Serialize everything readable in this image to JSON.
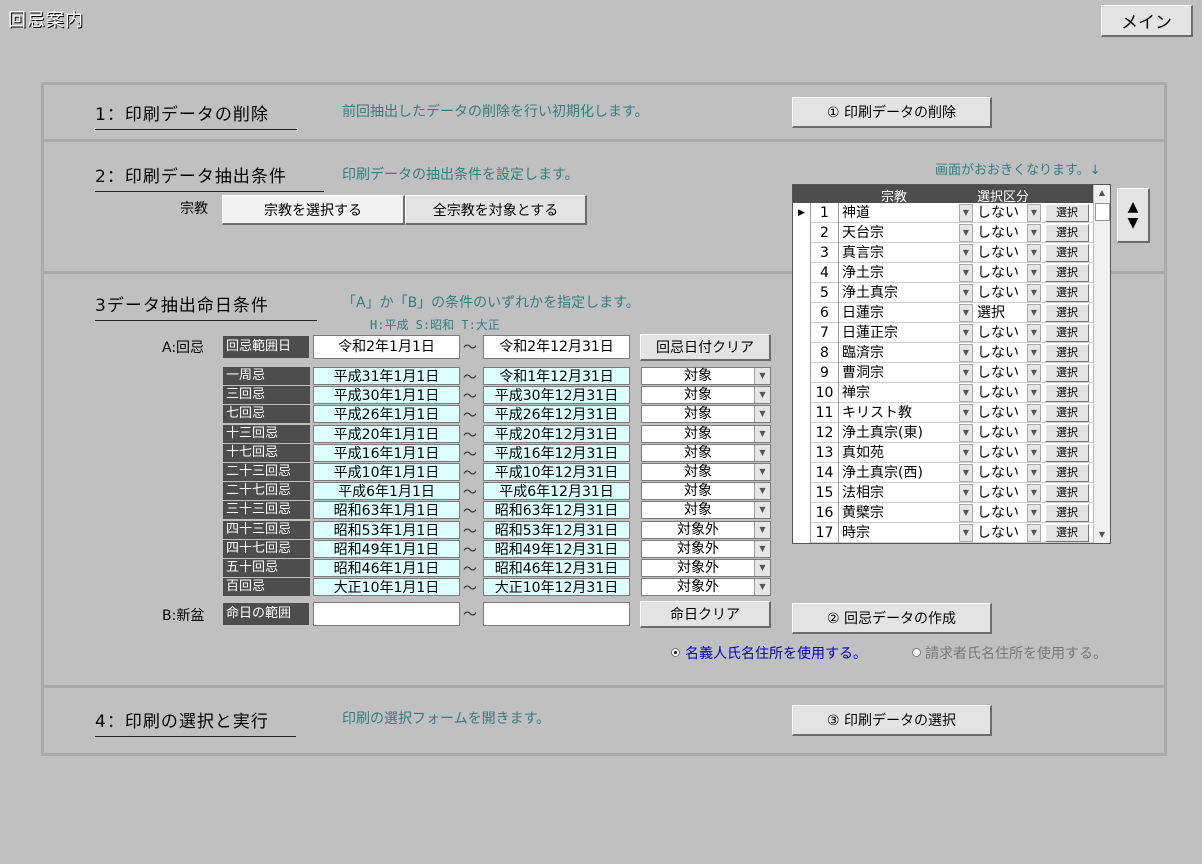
{
  "window": {
    "title": "回忌案内",
    "main_button": "メイン"
  },
  "section1": {
    "heading": "1：印刷データの削除",
    "description": "前回抽出したデータの削除を行い初期化します。",
    "button": "① 印刷データの削除"
  },
  "section2": {
    "heading": "2：印刷データ抽出条件",
    "description": "印刷データの抽出条件を設定します。",
    "sect_label": "宗教",
    "select_button": "宗教を選択する",
    "all_button": "全宗教を対象とする",
    "enlarge_hint": "画面がおおきくなります。↓"
  },
  "section3": {
    "heading": "3データ抽出命日条件",
    "description": "「A」か「B」の条件のいずれかを指定します。",
    "era_legend": "H:平成 S:昭和 T:大正",
    "a_label": "A:回忌",
    "range_label": "回忌範囲日",
    "range_from": "令和2年1月1日",
    "range_to": "令和2年12月31日",
    "clear_button": "回忌日付クリア",
    "kaiki_rows": [
      {
        "name": "一周忌",
        "from": "平成31年1月1日",
        "to": "令和1年12月31日",
        "status": "対象"
      },
      {
        "name": "三回忌",
        "from": "平成30年1月1日",
        "to": "平成30年12月31日",
        "status": "対象"
      },
      {
        "name": "七回忌",
        "from": "平成26年1月1日",
        "to": "平成26年12月31日",
        "status": "対象"
      },
      {
        "name": "十三回忌",
        "from": "平成20年1月1日",
        "to": "平成20年12月31日",
        "status": "対象"
      },
      {
        "name": "十七回忌",
        "from": "平成16年1月1日",
        "to": "平成16年12月31日",
        "status": "対象"
      },
      {
        "name": "二十三回忌",
        "from": "平成10年1月1日",
        "to": "平成10年12月31日",
        "status": "対象"
      },
      {
        "name": "二十七回忌",
        "from": "平成6年1月1日",
        "to": "平成6年12月31日",
        "status": "対象"
      },
      {
        "name": "三十三回忌",
        "from": "昭和63年1月1日",
        "to": "昭和63年12月31日",
        "status": "対象"
      },
      {
        "name": "四十三回忌",
        "from": "昭和53年1月1日",
        "to": "昭和53年12月31日",
        "status": "対象外"
      },
      {
        "name": "四十七回忌",
        "from": "昭和49年1月1日",
        "to": "昭和49年12月31日",
        "status": "対象外"
      },
      {
        "name": "五十回忌",
        "from": "昭和46年1月1日",
        "to": "昭和46年12月31日",
        "status": "対象外"
      },
      {
        "name": "百回忌",
        "from": "大正10年1月1日",
        "to": "大正10年12月31日",
        "status": "対象外"
      }
    ],
    "b_label": "B:新盆",
    "b_range_label": "命日の範囲",
    "b_from": "",
    "b_to": "",
    "b_clear_button": "命日クリア",
    "create_button": "② 回忌データの作成",
    "radio_1": "名義人氏名住所を使用する。",
    "radio_2": "請求者氏名住所を使用する。"
  },
  "section4": {
    "heading": "4：印刷の選択と実行",
    "description": "印刷の選択フォームを開きます。",
    "button": "③ 印刷データの選択"
  },
  "sect_grid": {
    "col_religion": "宗教",
    "col_kubun": "選択区分",
    "select_label": "選択",
    "rows": [
      {
        "no": "1",
        "name": "神道",
        "kubun": "しない"
      },
      {
        "no": "2",
        "name": "天台宗",
        "kubun": "しない"
      },
      {
        "no": "3",
        "name": "真言宗",
        "kubun": "しない"
      },
      {
        "no": "4",
        "name": "浄土宗",
        "kubun": "しない"
      },
      {
        "no": "5",
        "name": "浄土真宗",
        "kubun": "しない"
      },
      {
        "no": "6",
        "name": "日蓮宗",
        "kubun": "選択"
      },
      {
        "no": "7",
        "name": "日蓮正宗",
        "kubun": "しない"
      },
      {
        "no": "8",
        "name": "臨済宗",
        "kubun": "しない"
      },
      {
        "no": "9",
        "name": "曹洞宗",
        "kubun": "しない"
      },
      {
        "no": "10",
        "name": "禅宗",
        "kubun": "しない"
      },
      {
        "no": "11",
        "name": "キリスト教",
        "kubun": "しない"
      },
      {
        "no": "12",
        "name": "浄土真宗(東)",
        "kubun": "しない"
      },
      {
        "no": "13",
        "name": "真如苑",
        "kubun": "しない"
      },
      {
        "no": "14",
        "name": "浄土真宗(西)",
        "kubun": "しない"
      },
      {
        "no": "15",
        "name": "法相宗",
        "kubun": "しない"
      },
      {
        "no": "16",
        "name": "黄檗宗",
        "kubun": "しない"
      },
      {
        "no": "17",
        "name": "時宗",
        "kubun": "しない"
      }
    ]
  },
  "colors": {
    "background": "#c0c0c0",
    "description_text": "#2e7f85",
    "label_dark": "#4d4d4d",
    "date_field": "#dcffff",
    "radio_active": "#0000cc"
  }
}
